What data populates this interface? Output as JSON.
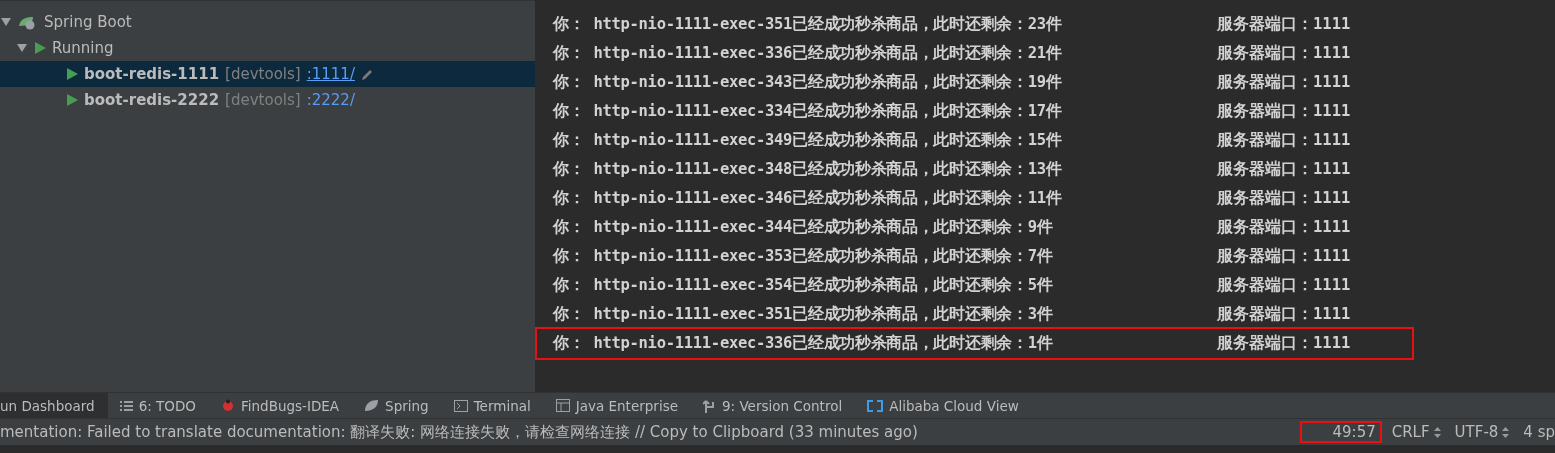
{
  "tree": {
    "root": {
      "label": "Spring Boot",
      "expanded": true
    },
    "group": {
      "label": "Running",
      "expanded": true
    },
    "apps": [
      {
        "name": "boot-redis-1111",
        "tag": "[devtools]",
        "port": ":1111/",
        "selected": true
      },
      {
        "name": "boot-redis-2222",
        "tag": "[devtools]",
        "port": ":2222/",
        "selected": false
      }
    ]
  },
  "console": {
    "lines": [
      {
        "message": "你： http-nio-1111-exec-351已经成功秒杀商品，此时还剩余：23件",
        "port": "服务器端口：1111",
        "highlighted": false
      },
      {
        "message": "你： http-nio-1111-exec-336已经成功秒杀商品，此时还剩余：21件",
        "port": "服务器端口：1111",
        "highlighted": false
      },
      {
        "message": "你： http-nio-1111-exec-343已经成功秒杀商品，此时还剩余：19件",
        "port": "服务器端口：1111",
        "highlighted": false
      },
      {
        "message": "你： http-nio-1111-exec-334已经成功秒杀商品，此时还剩余：17件",
        "port": "服务器端口：1111",
        "highlighted": false
      },
      {
        "message": "你： http-nio-1111-exec-349已经成功秒杀商品，此时还剩余：15件",
        "port": "服务器端口：1111",
        "highlighted": false
      },
      {
        "message": "你： http-nio-1111-exec-348已经成功秒杀商品，此时还剩余：13件",
        "port": "服务器端口：1111",
        "highlighted": false
      },
      {
        "message": "你： http-nio-1111-exec-346已经成功秒杀商品，此时还剩余：11件",
        "port": "服务器端口：1111",
        "highlighted": false
      },
      {
        "message": "你： http-nio-1111-exec-344已经成功秒杀商品，此时还剩余：9件",
        "port": "服务器端口：1111",
        "highlighted": false
      },
      {
        "message": "你： http-nio-1111-exec-353已经成功秒杀商品，此时还剩余：7件",
        "port": "服务器端口：1111",
        "highlighted": false
      },
      {
        "message": "你： http-nio-1111-exec-354已经成功秒杀商品，此时还剩余：5件",
        "port": "服务器端口：1111",
        "highlighted": false
      },
      {
        "message": "你： http-nio-1111-exec-351已经成功秒杀商品，此时还剩余：3件",
        "port": "服务器端口：1111",
        "highlighted": false
      },
      {
        "message": "你： http-nio-1111-exec-336已经成功秒杀商品，此时还剩余：1件",
        "port": "服务器端口：1111",
        "highlighted": true
      }
    ]
  },
  "tool_tabs": [
    {
      "kind": "dashboard",
      "label": "un Dashboard",
      "selected": true
    },
    {
      "kind": "list",
      "label": "6: TODO",
      "selected": false
    },
    {
      "kind": "bug",
      "label": "FindBugs-IDEA",
      "selected": false
    },
    {
      "kind": "leaf",
      "label": "Spring",
      "selected": false
    },
    {
      "kind": "terminal",
      "label": "Terminal",
      "selected": false
    },
    {
      "kind": "enterprise",
      "label": "Java Enterprise",
      "selected": false
    },
    {
      "kind": "vcs",
      "label": "9: Version Control",
      "selected": false
    },
    {
      "kind": "cloud",
      "label": "Alibaba Cloud View",
      "selected": false
    }
  ],
  "status_bar": {
    "message": "mentation: Failed to translate documentation: 翻译失败: 网络连接失败，请检查网络连接 // Copy to Clipboard (33 minutes ago)",
    "position": {
      "text": "49:57",
      "highlighted": true
    },
    "line_separator": "CRLF",
    "encoding": "UTF-8",
    "indent": "4 sp"
  }
}
